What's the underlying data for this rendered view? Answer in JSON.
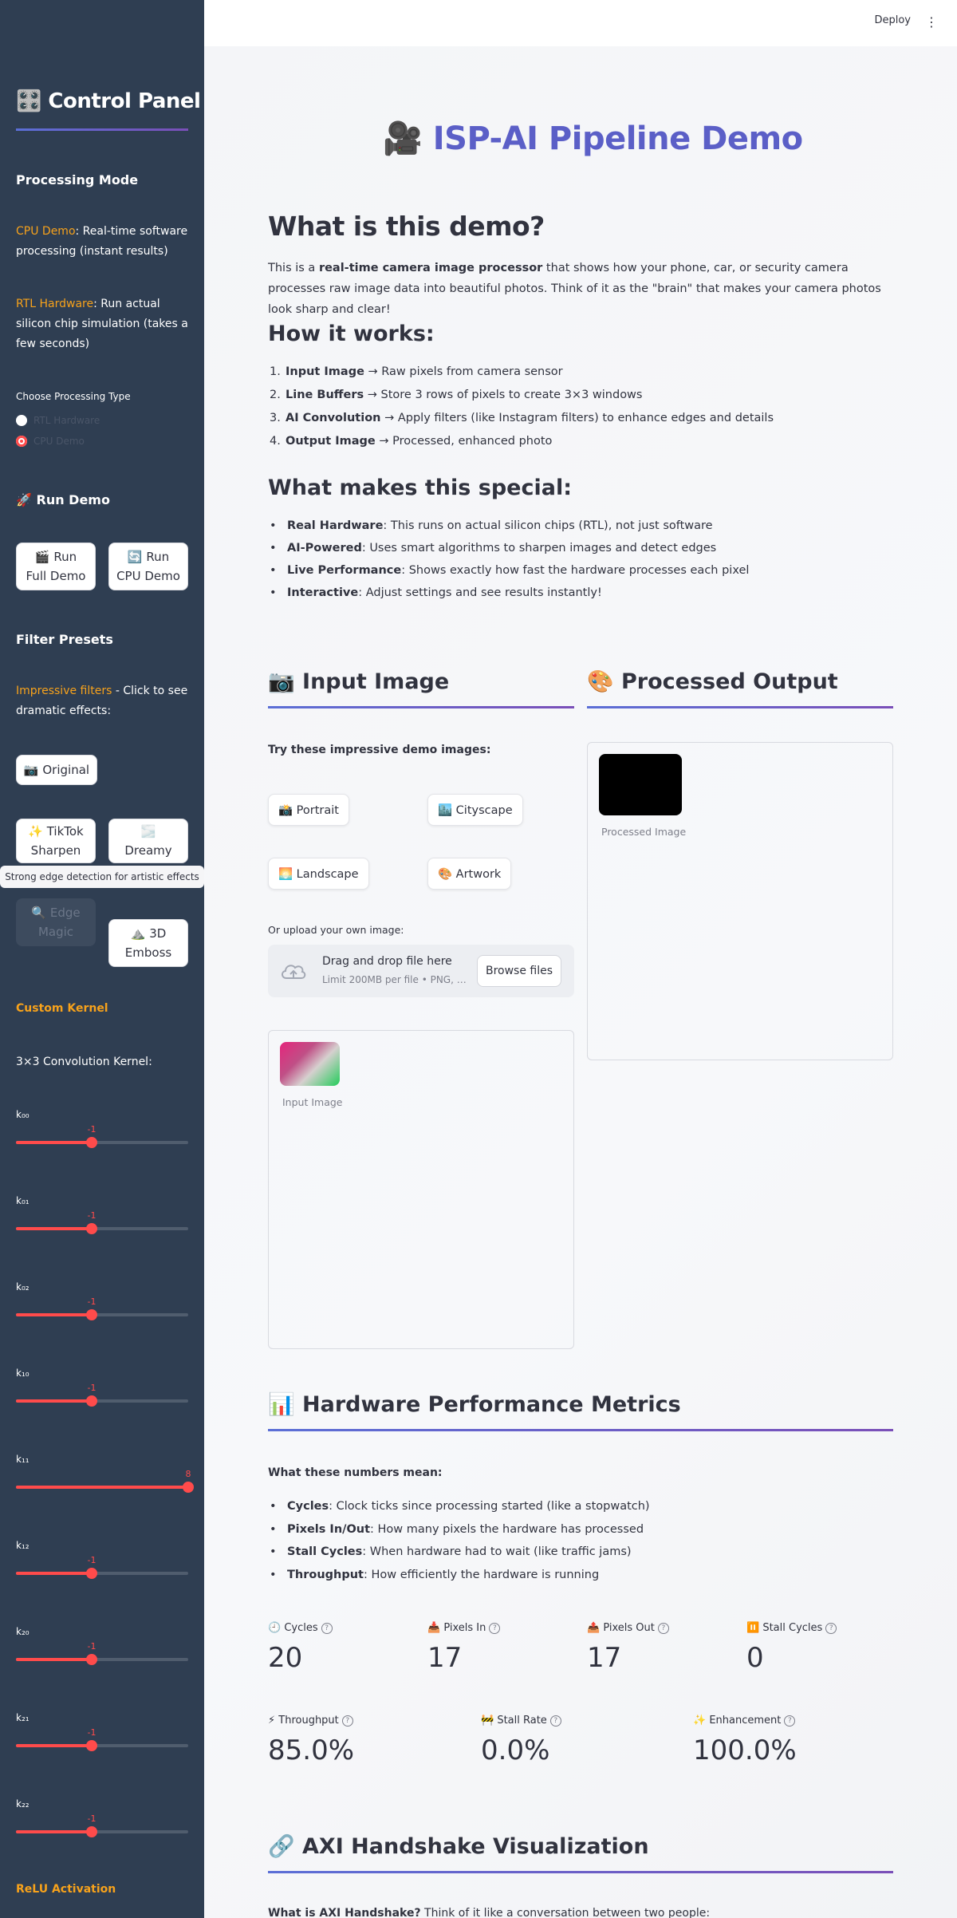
{
  "topbar": {
    "deploy_label": "Deploy",
    "menu_icon": "⋮"
  },
  "sidebar": {
    "title": "🎛️ Control Panel",
    "processing_mode": {
      "heading": "Processing Mode",
      "cpu_name": "CPU Demo",
      "cpu_desc": ": Real-time software processing (instant results)",
      "rtl_name": "RTL Hardware",
      "rtl_desc": ": Run actual silicon chip simulation (takes a few seconds)"
    },
    "processing_type": {
      "label": "Choose Processing Type",
      "options": [
        "RTL Hardware",
        "CPU Demo"
      ],
      "selected": "CPU Demo"
    },
    "run_demo": {
      "heading": "🚀 Run Demo",
      "full_icon": "🎬",
      "full_l1": "Run",
      "full_l2": "Full Demo",
      "cpu_icon": "🔄",
      "cpu_l1": "Run",
      "cpu_l2": "CPU Demo"
    },
    "filter_presets": {
      "heading": "Filter Presets",
      "intro_em": "Impressive filters",
      "intro_rest": " - Click to see dramatic effects:",
      "original": "📷 Original",
      "tiktok_icon": "✨",
      "tiktok_l1": "TikTok",
      "tiktok_l2": "Sharpen",
      "dreamy_icon": "🌫️",
      "dreamy_l2": "Dreamy",
      "edge_icon": "🔍",
      "edge_l1": "Edge",
      "edge_l2": "Magic",
      "emboss_icon": "⛰️",
      "emboss_l1": "3D",
      "emboss_l2": "Emboss",
      "tooltip": "Strong edge detection for artistic effects"
    },
    "custom_kernel": {
      "heading": "Custom Kernel",
      "label": "3×3 Convolution Kernel:",
      "sliders": [
        {
          "name": "k₀₀",
          "value": -1,
          "min": -8,
          "max": 8
        },
        {
          "name": "k₀₁",
          "value": -1,
          "min": -8,
          "max": 8
        },
        {
          "name": "k₀₂",
          "value": -1,
          "min": -8,
          "max": 8
        },
        {
          "name": "k₁₀",
          "value": -1,
          "min": -8,
          "max": 8
        },
        {
          "name": "k₁₁",
          "value": 8,
          "min": -8,
          "max": 8
        },
        {
          "name": "k₁₂",
          "value": -1,
          "min": -8,
          "max": 8
        },
        {
          "name": "k₂₀",
          "value": -1,
          "min": -8,
          "max": 8
        },
        {
          "name": "k₂₁",
          "value": -1,
          "min": -8,
          "max": 8
        },
        {
          "name": "k₂₂",
          "value": -1,
          "min": -8,
          "max": 8
        }
      ]
    },
    "relu_heading": "ReLU Activation"
  },
  "main": {
    "title_icon": "🎥",
    "title": "ISP-AI Pipeline Demo",
    "what_heading": "What is this demo?",
    "what_p_a": "This is a ",
    "what_p_b": "real-time camera image processor",
    "what_p_c": " that shows how your phone, car, or security camera processes raw image data into beautiful photos. Think of it as the \"brain\" that makes your camera photos look sharp and clear!",
    "how_heading": "How it works:",
    "how_steps": [
      {
        "n": "1.",
        "b": "Input Image",
        "t": " → Raw pixels from camera sensor"
      },
      {
        "n": "2.",
        "b": "Line Buffers",
        "t": " → Store 3 rows of pixels to create 3×3 windows"
      },
      {
        "n": "3.",
        "b": "AI Convolution",
        "t": " → Apply filters (like Instagram filters) to enhance edges and details"
      },
      {
        "n": "4.",
        "b": "Output Image",
        "t": " → Processed, enhanced photo"
      }
    ],
    "special_heading": "What makes this special:",
    "special_items": [
      {
        "b": "Real Hardware",
        "t": ": This runs on actual silicon chips (RTL), not just software"
      },
      {
        "b": "AI-Powered",
        "t": ": Uses smart algorithms to sharpen images and detect edges"
      },
      {
        "b": "Live Performance",
        "t": ": Shows exactly how fast the hardware processes each pixel"
      },
      {
        "b": "Interactive",
        "t": ": Adjust settings and see results instantly!"
      }
    ],
    "input_heading": "📷 Input Image",
    "output_heading": "🎨 Processed Output",
    "try_label": "Try these impressive demo images:",
    "demo_images": [
      "📸 Portrait",
      "🏙️ Cityscape",
      "🌅 Landscape",
      "🎨 Artwork"
    ],
    "upload_label": "Or upload your own image:",
    "drop_title": "Drag and drop file here",
    "drop_limit": "Limit 200MB per file • PNG, …",
    "browse_label": "Browse files",
    "input_caption": "Input Image",
    "output_caption": "Processed Image",
    "metrics_heading": "📊 Hardware Performance Metrics",
    "metrics_intro": "What these numbers mean:",
    "metrics_explain": [
      {
        "b": "Cycles",
        "t": ": Clock ticks since processing started (like a stopwatch)"
      },
      {
        "b": "Pixels In/Out",
        "t": ": How many pixels the hardware has processed"
      },
      {
        "b": "Stall Cycles",
        "t": ": When hardware had to wait (like traffic jams)"
      },
      {
        "b": "Throughput",
        "t": ": How efficiently the hardware is running"
      }
    ],
    "metrics_row1": [
      {
        "label": "🕘 Cycles",
        "value": "20"
      },
      {
        "label": "📥 Pixels In",
        "value": "17"
      },
      {
        "label": "📤 Pixels Out",
        "value": "17"
      },
      {
        "label": "⏸️ Stall Cycles",
        "value": "0"
      }
    ],
    "metrics_row2": [
      {
        "label": "⚡ Throughput",
        "value": "85.0%"
      },
      {
        "label": "🚧 Stall Rate",
        "value": "0.0%"
      },
      {
        "label": "✨ Enhancement",
        "value": "100.0%"
      }
    ],
    "axi_heading": "🔗 AXI Handshake Visualization",
    "axi_intro_b": "What is AXI Handshake?",
    "axi_intro_t": " Think of it like a conversation between two people:",
    "colors": {
      "accent": "#5b5fc7",
      "sidebar_bg": "#2f3e52",
      "orange": "#f7a21b",
      "slider_red": "#ff4b4b"
    }
  }
}
